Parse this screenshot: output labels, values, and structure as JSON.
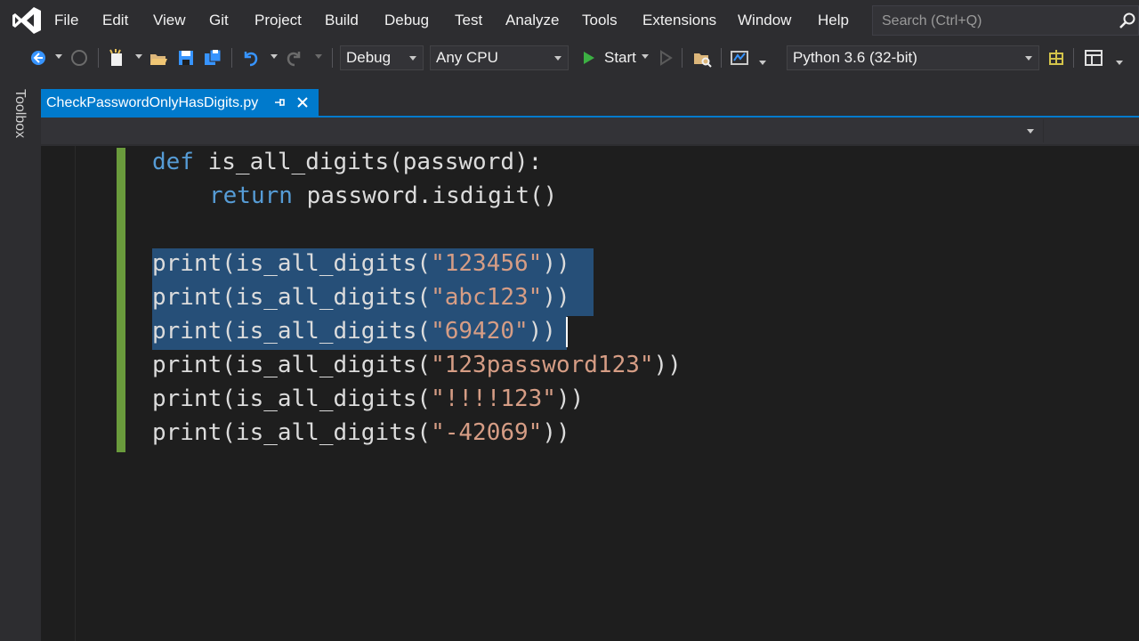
{
  "menu": {
    "items": [
      "File",
      "Edit",
      "View",
      "Git",
      "Project",
      "Build",
      "Debug",
      "Test",
      "Analyze",
      "Tools",
      "Extensions",
      "Window",
      "Help"
    ],
    "search_placeholder": "Search (Ctrl+Q)"
  },
  "toolbar": {
    "configuration": "Debug",
    "platform": "Any CPU",
    "start_label": "Start",
    "environment": "Python 3.6 (32-bit)"
  },
  "toolbox": {
    "label": "Toolbox"
  },
  "document": {
    "tab_title": "CheckPasswordOnlyHasDigits.py"
  },
  "code": {
    "lines": [
      {
        "keyword": "def",
        "rest": " is_all_digits(password):"
      },
      {
        "keyword": "return",
        "rest": " password.isdigit()"
      },
      {
        "pre": "print(is_all_digits(",
        "str": "\"123456\"",
        "post": "))"
      },
      {
        "pre": "print(is_all_digits(",
        "str": "\"abc123\"",
        "post": "))"
      },
      {
        "pre": "print(is_all_digits(",
        "str": "\"69420\"",
        "post": "))"
      },
      {
        "pre": "print(is_all_digits(",
        "str": "\"123password123\"",
        "post": "))"
      },
      {
        "pre": "print(is_all_digits(",
        "str": "\"!!!!123\"",
        "post": "))"
      },
      {
        "pre": "print(is_all_digits(",
        "str": "\"-42069\"",
        "post": "))"
      }
    ]
  },
  "colors": {
    "accent": "#007acc",
    "keyword": "#569cd6",
    "string": "#d69d85",
    "selection": "#264f78",
    "change_bar": "#6a9b3c"
  }
}
